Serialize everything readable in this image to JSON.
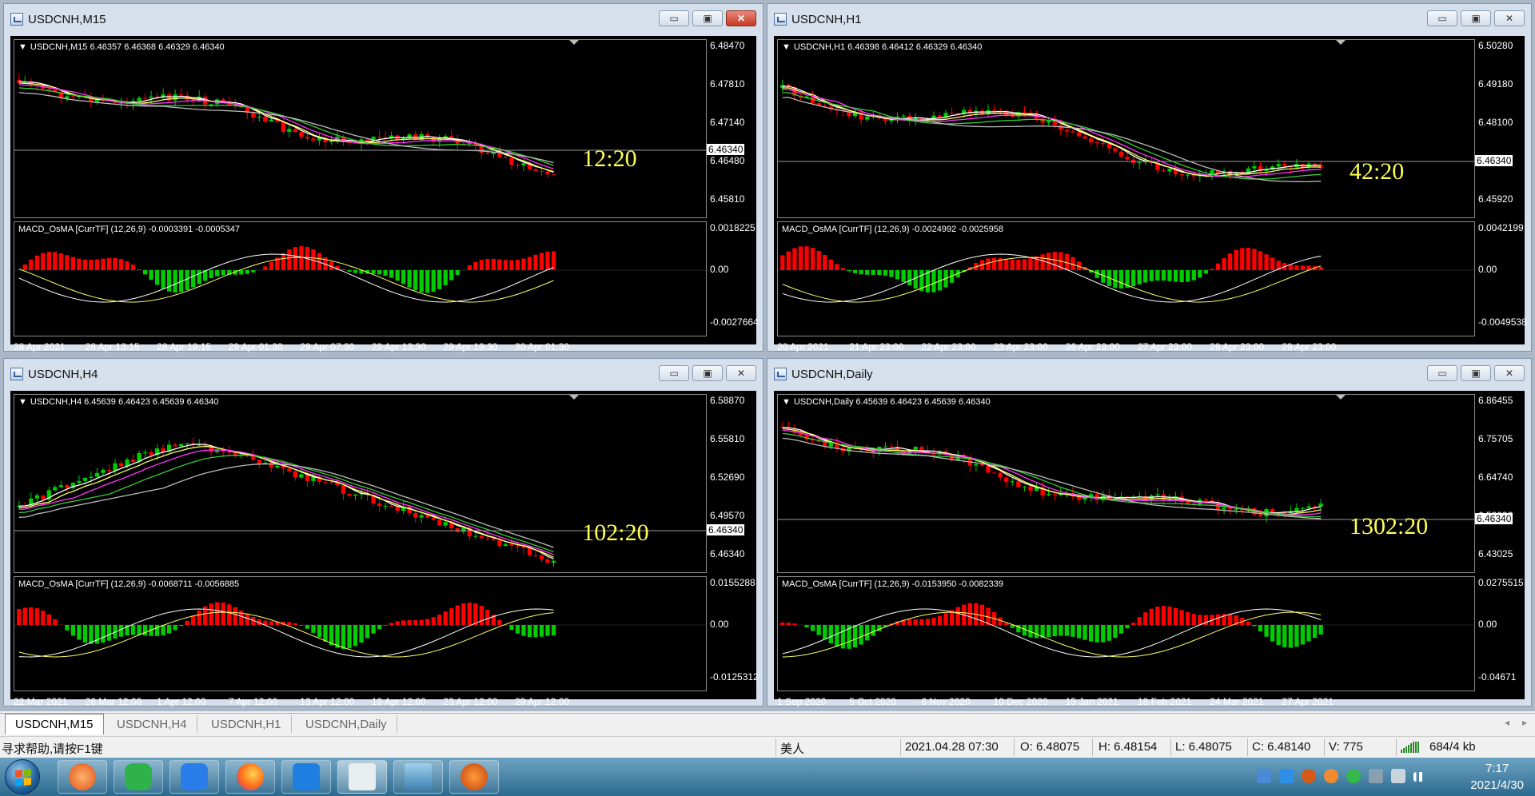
{
  "charts": [
    {
      "id": "m15",
      "title": "USDCNH,M15",
      "info": "USDCNH,M15  6.46357 6.46368 6.46329 6.46340",
      "prices": [
        "6.48470",
        "6.47810",
        "6.47140",
        "6.46480",
        "6.45810"
      ],
      "current": "6.46340",
      "osc_info": "MACD_OsMA [CurrTF] (12,26,9) -0.0003391 -0.0005347",
      "osc_ticks": [
        "0.0018225",
        "0.00",
        "-0.0027664"
      ],
      "timer": "12:20",
      "x_labels": [
        "28 Apr 2021",
        "28 Apr 13:15",
        "28 Apr 19:15",
        "29 Apr 01:30",
        "29 Apr 07:30",
        "29 Apr 13:30",
        "29 Apr 19:30",
        "30 Apr 01:30"
      ]
    },
    {
      "id": "h1",
      "title": "USDCNH,H1",
      "info": "USDCNH,H1  6.46398 6.46412 6.46329 6.46340",
      "prices": [
        "6.50280",
        "6.49180",
        "6.48100",
        "6.47020",
        "6.45920"
      ],
      "current": "6.46340",
      "osc_info": "MACD_OsMA [CurrTF] (12,26,9) -0.0024992 -0.0025958",
      "osc_ticks": [
        "0.0042199",
        "0.00",
        "-0.0049538"
      ],
      "timer": "42:20",
      "x_labels": [
        "20 Apr 2021",
        "21 Apr 23:00",
        "22 Apr 23:00",
        "23 Apr 23:00",
        "26 Apr 23:00",
        "27 Apr 23:00",
        "28 Apr 23:00",
        "29 Apr 23:00"
      ]
    },
    {
      "id": "h4",
      "title": "USDCNH,H4",
      "info": "USDCNH,H4  6.45639 6.46423 6.45639 6.46340",
      "prices": [
        "6.58870",
        "6.55810",
        "6.52690",
        "6.49570",
        "6.46340"
      ],
      "current": "6.46340",
      "osc_info": "MACD_OsMA [CurrTF] (12,26,9) -0.0068711 -0.0056885",
      "osc_ticks": [
        "0.0155288",
        "0.00",
        "-0.0125312"
      ],
      "timer": "102:20",
      "x_labels": [
        "22 Mar 2021",
        "26 Mar 12:00",
        "1 Apr 12:00",
        "7 Apr 12:00",
        "13 Apr 12:00",
        "19 Apr 12:00",
        "23 Apr 12:00",
        "29 Apr 12:00"
      ]
    },
    {
      "id": "daily",
      "title": "USDCNH,Daily",
      "info": "USDCNH,Daily  6.45639 6.46423 6.45639 6.46340",
      "prices": [
        "6.86455",
        "6.75705",
        "6.64740",
        "6.53990",
        "6.43025"
      ],
      "current": "6.46340",
      "osc_info": "MACD_OsMA [CurrTF] (12,26,9) -0.0153950 -0.0082339",
      "osc_ticks": [
        "0.0275515",
        "0.00",
        "-0.04671"
      ],
      "timer": "1302:20",
      "x_labels": [
        "1 Sep 2020",
        "5 Oct 2020",
        "6 Nov 2020",
        "10 Dec 2020",
        "15 Jan 2021",
        "18 Feb 2021",
        "24 Mar 2021",
        "27 Apr 2021"
      ]
    }
  ],
  "window_buttons": {
    "minimize": "▭",
    "restore": "▣",
    "close": "✕"
  },
  "tabs": [
    "USDCNH,M15",
    "USDCNH,H4",
    "USDCNH,H1",
    "USDCNH,Daily"
  ],
  "active_tab": 0,
  "tab_arrows": [
    "◂",
    "▸"
  ],
  "status": {
    "help": "寻求帮助,请按F1键",
    "profile": "美人",
    "datetime": "2021.04.28 07:30",
    "open": "O: 6.48075",
    "high": "H: 6.48154",
    "low": "L: 6.48075",
    "close": "C: 6.48140",
    "volume": "V: 775",
    "traffic": "684/4 kb"
  },
  "clock": {
    "time": "7:17",
    "date": "2021/4/30"
  },
  "colors": {
    "bull": "#00cc00",
    "bear": "#ff0000",
    "timer": "#ffff55",
    "ma_yellow": "#ffff66",
    "ma_white": "#ffffff",
    "ma_magenta": "#ff33ff",
    "ma_green": "#33cc33",
    "ma_gray": "#bbbbbb"
  }
}
